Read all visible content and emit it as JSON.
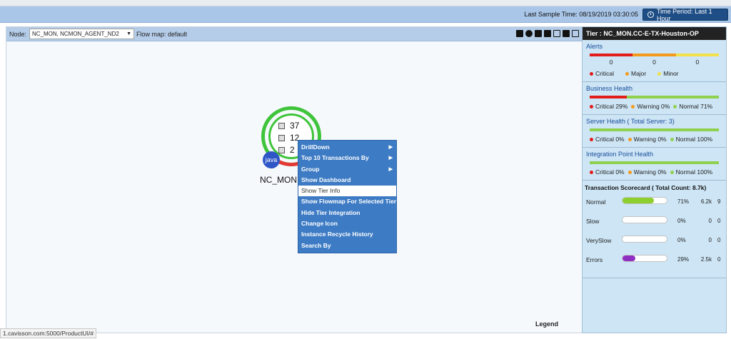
{
  "header": {
    "last_sample_time": "Last Sample Time: 08/19/2019 03:30:05",
    "time_period_button": "Time Period: Last 1 Hour"
  },
  "toolbar": {
    "node_label": "Node:",
    "node_value": "NC_MON, NCMON_AGENT_ND2",
    "flowmap_label": "Flow map: default"
  },
  "node": {
    "stat1": "37",
    "stat2": "12",
    "stat3": "2",
    "badge": "java",
    "name": "NC_MON."
  },
  "context_menu": {
    "items": [
      {
        "label": "DrillDown",
        "submenu": true
      },
      {
        "label": "Top 10 Transactions By",
        "submenu": true
      },
      {
        "label": "Group",
        "submenu": true
      },
      {
        "label": "Show Dashboard",
        "submenu": false
      },
      {
        "label": "Show Tier Info",
        "submenu": false,
        "highlighted": true
      },
      {
        "label": "Show Flowmap For Selected Tier",
        "submenu": false
      },
      {
        "label": "Hide Tier Integration",
        "submenu": false
      },
      {
        "label": "Change Icon",
        "submenu": false
      },
      {
        "label": "Instance Recycle History",
        "submenu": false
      },
      {
        "label": "Search By",
        "submenu": false
      }
    ],
    "arrow_glyph": "▶"
  },
  "legend": "Legend",
  "side_panel": {
    "tier_title": "Tier : NC_MON.CC-E-TX-Houston-OP",
    "alerts": {
      "title": "Alerts",
      "counts": [
        "0",
        "0",
        "0"
      ],
      "critical": "Critical",
      "major": "Major",
      "minor": "Minor"
    },
    "business_health": {
      "title": "Business Health",
      "critical": "Critical 29%",
      "warning": "Warning 0%",
      "normal": "Normal 71%",
      "critical_pct": 29,
      "normal_pct": 71
    },
    "server_health": {
      "title": "Server Health ( Total Server: 3)",
      "critical": "Critical 0%",
      "warning": "Warning 0%",
      "normal": "Normal 100%"
    },
    "integration_health": {
      "title": "Integration Point Health",
      "critical": "Critical 0%",
      "warning": "Warning 0%",
      "normal": "Normal 100%"
    },
    "scorecard": {
      "title": "Transaction Scorecard  ( Total Count: 8.7k)",
      "rows": [
        {
          "label": "Normal",
          "pct": "71%",
          "count": "6.2k",
          "x": "9",
          "fill": 71,
          "color": "#8dcf2f"
        },
        {
          "label": "Slow",
          "pct": "0%",
          "count": "0",
          "x": "0",
          "fill": 0,
          "color": "#f0a030"
        },
        {
          "label": "VerySlow",
          "pct": "0%",
          "count": "0",
          "x": "0",
          "fill": 0,
          "color": "#e53935"
        },
        {
          "label": "Errors",
          "pct": "29%",
          "count": "2.5k",
          "x": "0",
          "fill": 29,
          "color": "#8e2fc2"
        }
      ]
    }
  },
  "colors": {
    "critical": "#e21b1b",
    "major": "#f39a1d",
    "minor": "#f2e14b",
    "normal": "#8fd14f"
  },
  "status_url": "1.cavisson.com:5000/ProductUI/#"
}
